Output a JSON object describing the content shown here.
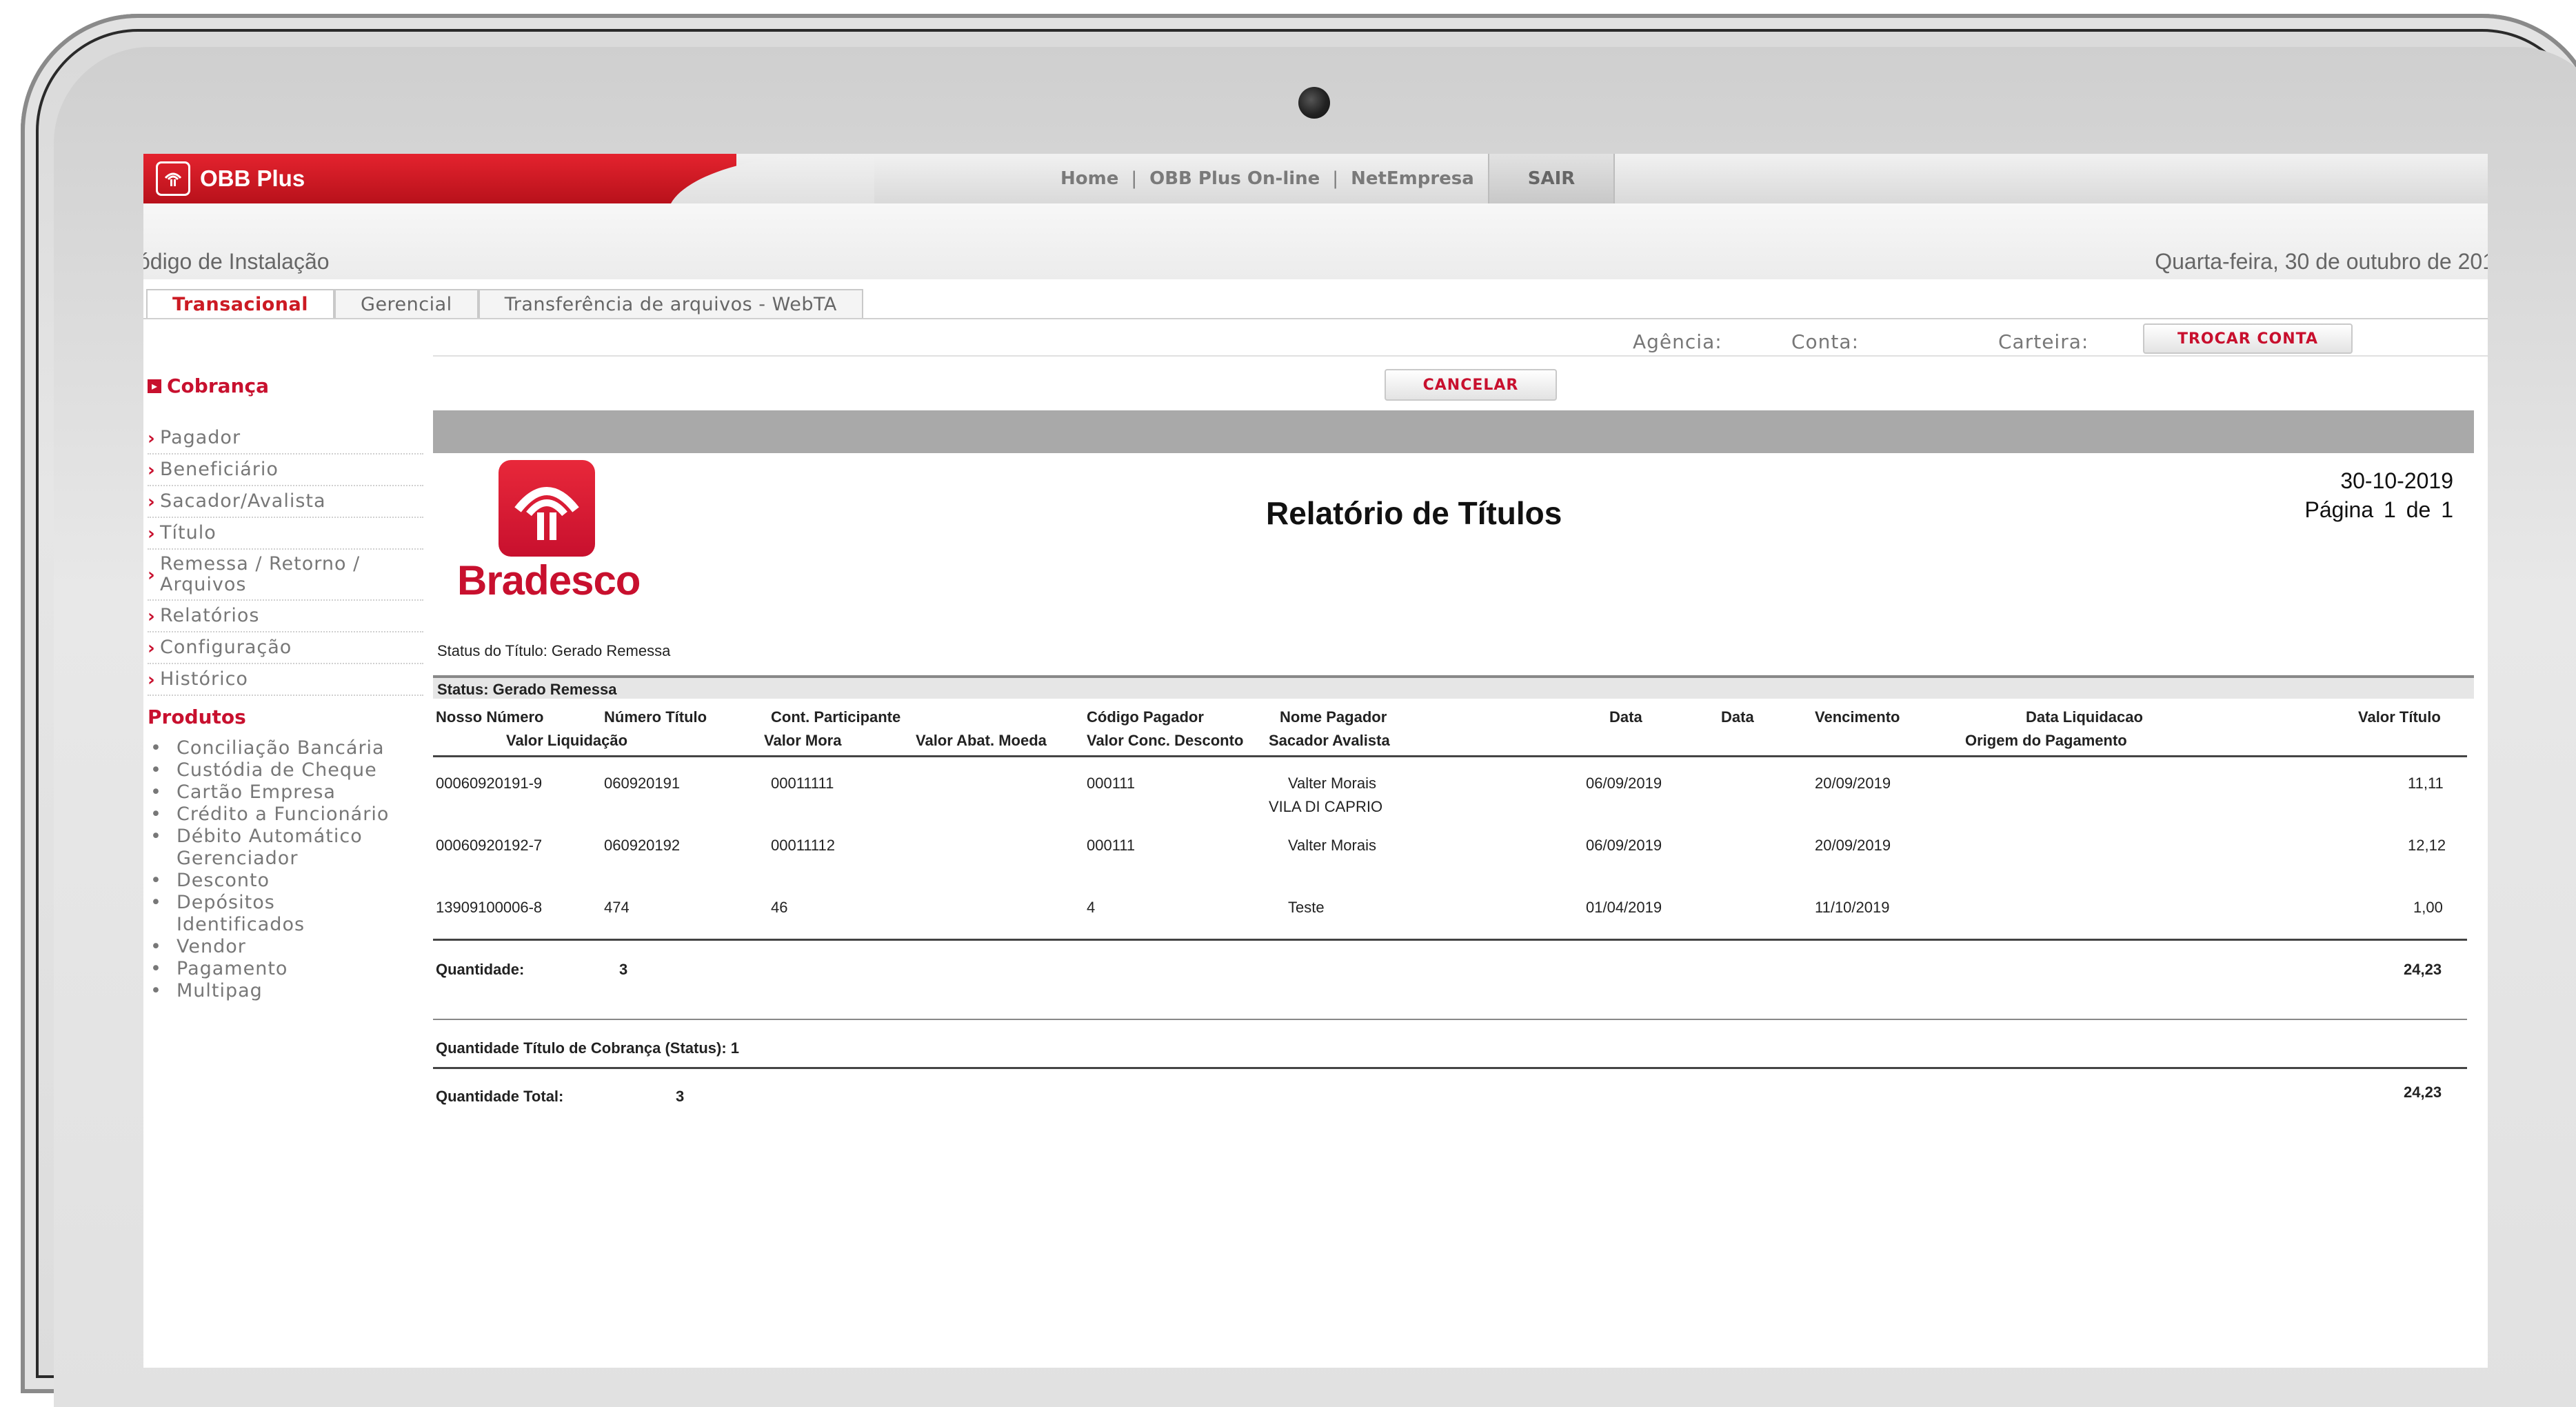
{
  "topbar": {
    "brand": "OBB Plus",
    "nav": [
      "Home",
      "OBB Plus On-line",
      "NetEmpresa"
    ],
    "exit": "SAIR"
  },
  "header": {
    "install_label": "ódigo de Instalação",
    "date": "Quarta-feira, 30 de outubro de 201"
  },
  "tabs": [
    "Transacional",
    "Gerencial",
    "Transferência de arquivos - WebTA"
  ],
  "account": {
    "agencia": "Agência:",
    "conta": "Conta:",
    "carteira": "Carteira:",
    "switch_button": "TROCAR CONTA"
  },
  "sidebar": {
    "section": "Cobrança",
    "items": [
      "Pagador",
      "Beneficiário",
      "Sacador/Avalista",
      "Título",
      "Remessa / Retorno / Arquivos",
      "Relatórios",
      "Configuração",
      "Histórico"
    ],
    "products_title": "Produtos",
    "products": [
      "Conciliação Bancária",
      "Custódia de Cheque",
      "Cartão Empresa",
      "Crédito a Funcionário",
      "Débito Automático Gerenciador",
      "Desconto",
      "Depósitos Identificados",
      "Vendor",
      "Pagamento",
      "Multipag"
    ]
  },
  "actions": {
    "cancel": "CANCELAR"
  },
  "report": {
    "logo_text": "Bradesco",
    "title": "Relatório de Títulos",
    "date": "30-10-2019",
    "page": "Página 1 de   1",
    "status_line": "Status do Título: Gerado Remessa",
    "status_bar": "Status: Gerado Remessa",
    "headers_row1": [
      "Nosso Número",
      "Número Título",
      "Cont. Participante",
      "Código Pagador",
      "Nome Pagador",
      "Data",
      "Data",
      "Vencimento",
      "Data Liquidacao",
      "Valor Título"
    ],
    "headers_row2": [
      "Valor Liquidação",
      "Valor Mora",
      "Valor Abat. Moeda",
      "Valor Conc. Desconto",
      "Sacador Avalista",
      "Origem do Pagamento"
    ],
    "rows": [
      {
        "nosso_numero": "00060920191-9",
        "numero_titulo": "060920191",
        "participante": "00011111",
        "codigo_pagador": "000111",
        "nome_pagador": "Valter Morais",
        "sacador": "VILA DI CAPRIO",
        "data": "06/09/2019",
        "vencimento": "20/09/2019",
        "valor": "11,11"
      },
      {
        "nosso_numero": "00060920192-7",
        "numero_titulo": "060920192",
        "participante": "00011112",
        "codigo_pagador": "000111",
        "nome_pagador": "Valter Morais",
        "sacador": "",
        "data": "06/09/2019",
        "vencimento": "20/09/2019",
        "valor": "12,12"
      },
      {
        "nosso_numero": "13909100006-8",
        "numero_titulo": "474",
        "participante": "46",
        "codigo_pagador": "4",
        "nome_pagador": "Teste",
        "sacador": "",
        "data": "01/04/2019",
        "vencimento": "11/10/2019",
        "valor": "1,00"
      }
    ],
    "quantidade_label": "Quantidade:",
    "quantidade": "3",
    "subtotal": "24,23",
    "qtd_status_label": "Quantidade Título de Cobrança (Status): 1",
    "qtd_total_label": "Quantidade Total:",
    "qtd_total": "3",
    "total": "24,23"
  },
  "colors": {
    "brand_red": "#c8102e",
    "band_gray": "#a9a9a9"
  }
}
